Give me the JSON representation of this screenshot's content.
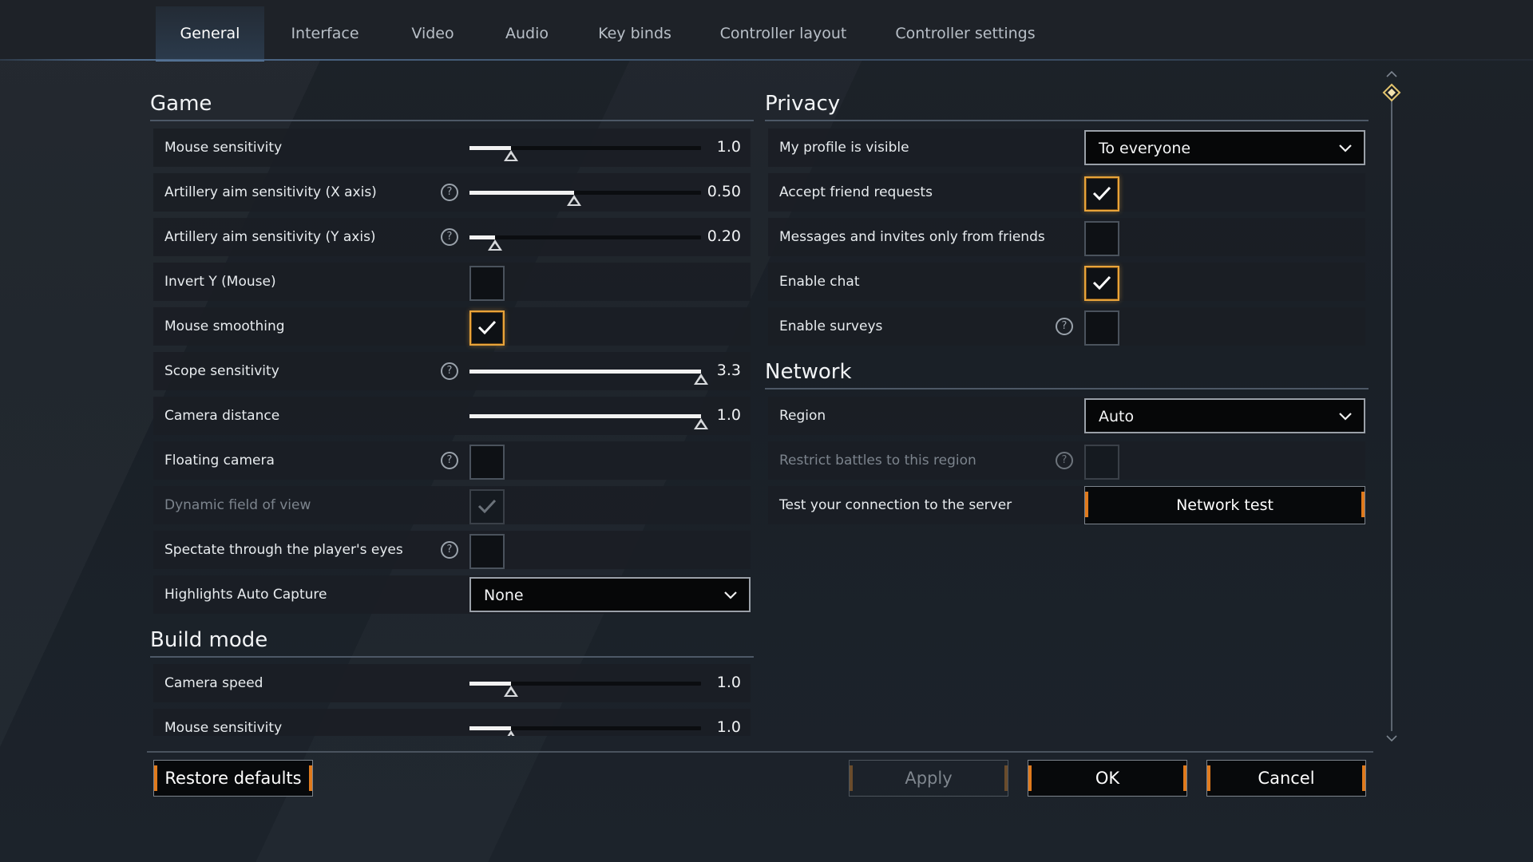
{
  "tabs": [
    {
      "label": "General",
      "active": true
    },
    {
      "label": "Interface"
    },
    {
      "label": "Video"
    },
    {
      "label": "Audio"
    },
    {
      "label": "Key binds"
    },
    {
      "label": "Controller layout"
    },
    {
      "label": "Controller settings"
    }
  ],
  "game": {
    "title": "Game",
    "mouse_sensitivity": {
      "label": "Mouse sensitivity",
      "value": "1.0",
      "fraction": 0.18
    },
    "artillery_x": {
      "label": "Artillery aim sensitivity (X axis)",
      "value": "0.50",
      "fraction": 0.45
    },
    "artillery_y": {
      "label": "Artillery aim sensitivity (Y axis)",
      "value": "0.20",
      "fraction": 0.11
    },
    "invert_y": {
      "label": "Invert Y (Mouse)",
      "checked": false
    },
    "mouse_smoothing": {
      "label": "Mouse smoothing",
      "checked": true
    },
    "scope_sensitivity": {
      "label": "Scope sensitivity",
      "value": "3.3",
      "fraction": 1.0
    },
    "camera_distance": {
      "label": "Camera distance",
      "value": "1.0",
      "fraction": 1.0
    },
    "floating_camera": {
      "label": "Floating camera",
      "checked": false
    },
    "dynamic_fov": {
      "label": "Dynamic field of view",
      "checked": true,
      "disabled": true
    },
    "spectate_eyes": {
      "label": "Spectate through the player's eyes",
      "checked": false
    },
    "highlights": {
      "label": "Highlights Auto Capture",
      "value": "None"
    }
  },
  "build": {
    "title": "Build mode",
    "camera_speed": {
      "label": "Camera speed",
      "value": "1.0",
      "fraction": 0.18
    },
    "mouse_sensitivity": {
      "label": "Mouse sensitivity",
      "value": "1.0",
      "fraction": 0.18
    }
  },
  "privacy": {
    "title": "Privacy",
    "profile_visible": {
      "label": "My profile is visible",
      "value": "To everyone"
    },
    "friend_requests": {
      "label": "Accept friend requests",
      "checked": true
    },
    "friends_only": {
      "label": "Messages and invites only from friends",
      "checked": false
    },
    "enable_chat": {
      "label": "Enable chat",
      "checked": true
    },
    "enable_surveys": {
      "label": "Enable surveys",
      "checked": false
    }
  },
  "network": {
    "title": "Network",
    "region": {
      "label": "Region",
      "value": "Auto"
    },
    "restrict": {
      "label": "Restrict battles to this region",
      "checked": false,
      "disabled": true
    },
    "test": {
      "label": "Test your connection to the server",
      "button": "Network test"
    }
  },
  "help_glyph": "?",
  "footer": {
    "restore": "Restore defaults",
    "apply": "Apply",
    "ok": "OK",
    "cancel": "Cancel"
  },
  "colors": {
    "accent_orange": "#e9a43a",
    "tab_active": "#5d81a8"
  }
}
